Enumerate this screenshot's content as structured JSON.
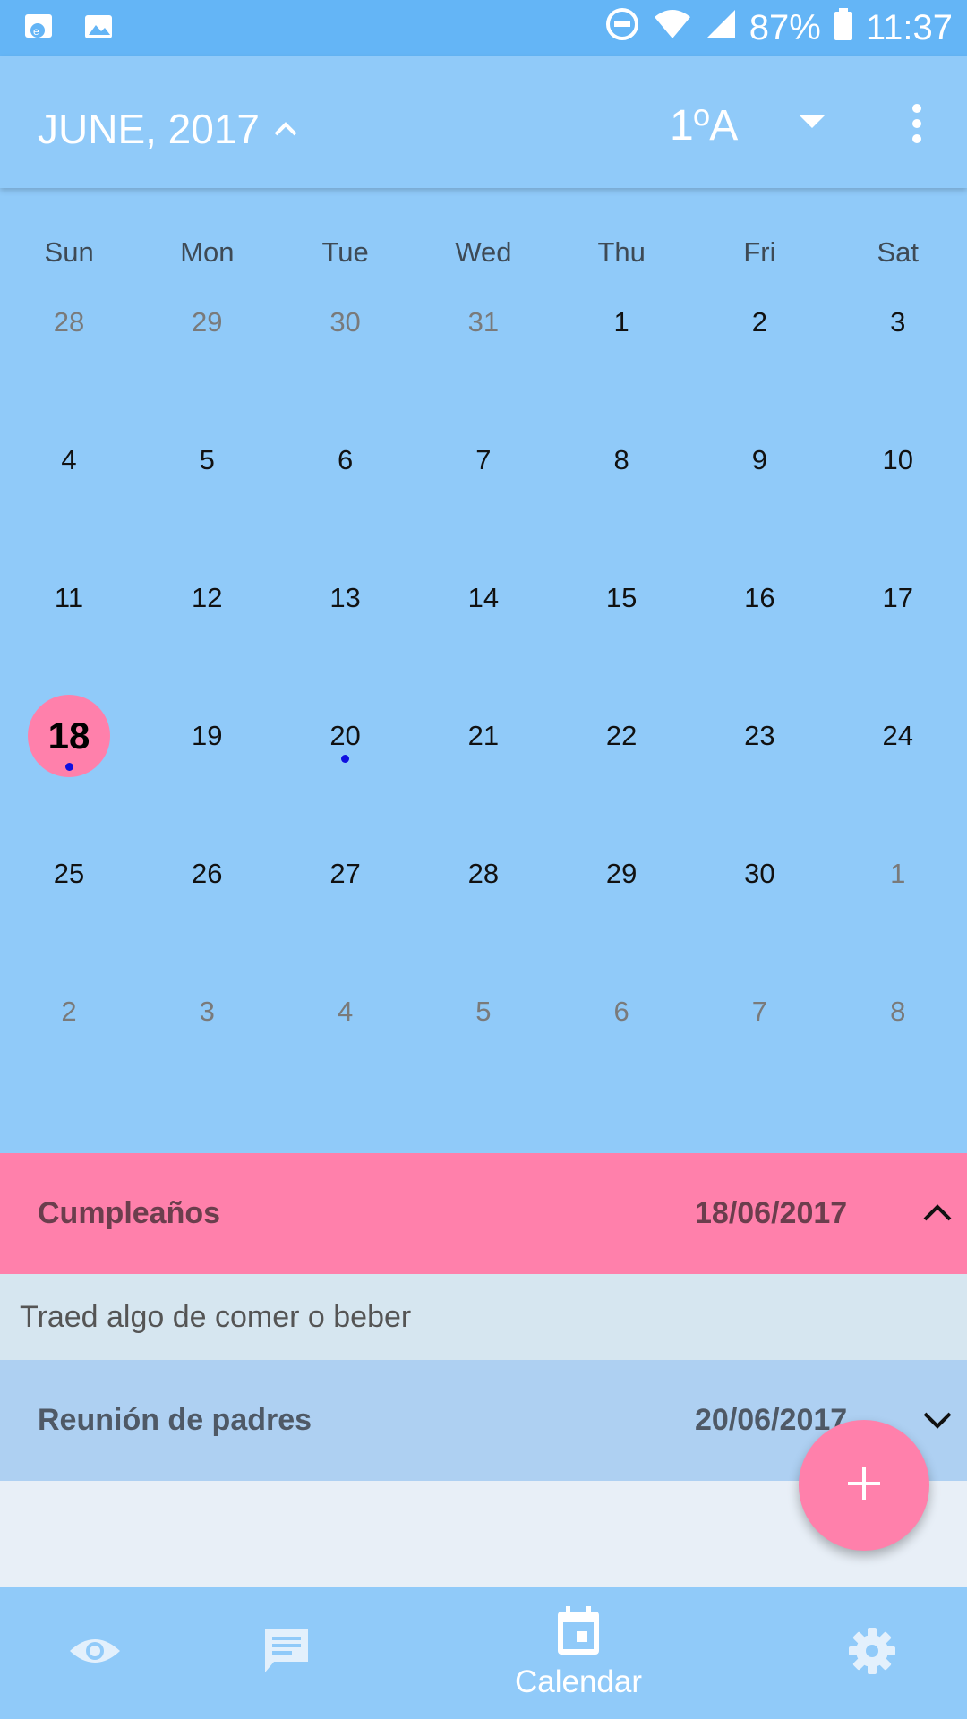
{
  "status_bar": {
    "battery": "87%",
    "time": "11:37",
    "icons": [
      "app-notification-icon",
      "image-notification-icon",
      "do-not-disturb-icon",
      "wifi-icon",
      "signal-icon",
      "battery-icon"
    ]
  },
  "app_bar": {
    "month_title": "JUNE, 2017",
    "class_selected": "1ºA",
    "icons": [
      "chevron-up-icon",
      "dropdown-caret-icon",
      "more-vert-icon"
    ]
  },
  "calendar": {
    "weekdays": [
      "Sun",
      "Mon",
      "Tue",
      "Wed",
      "Thu",
      "Fri",
      "Sat"
    ],
    "weeks": [
      [
        {
          "d": "28",
          "o": true
        },
        {
          "d": "29",
          "o": true
        },
        {
          "d": "30",
          "o": true
        },
        {
          "d": "31",
          "o": true
        },
        {
          "d": "1"
        },
        {
          "d": "2"
        },
        {
          "d": "3"
        }
      ],
      [
        {
          "d": "4"
        },
        {
          "d": "5"
        },
        {
          "d": "6"
        },
        {
          "d": "7"
        },
        {
          "d": "8"
        },
        {
          "d": "9"
        },
        {
          "d": "10"
        }
      ],
      [
        {
          "d": "11"
        },
        {
          "d": "12"
        },
        {
          "d": "13"
        },
        {
          "d": "14"
        },
        {
          "d": "15"
        },
        {
          "d": "16"
        },
        {
          "d": "17"
        }
      ],
      [
        {
          "d": "18",
          "today": true,
          "event": true
        },
        {
          "d": "19"
        },
        {
          "d": "20",
          "event": true
        },
        {
          "d": "21"
        },
        {
          "d": "22"
        },
        {
          "d": "23"
        },
        {
          "d": "24"
        }
      ],
      [
        {
          "d": "25"
        },
        {
          "d": "26"
        },
        {
          "d": "27"
        },
        {
          "d": "28"
        },
        {
          "d": "29"
        },
        {
          "d": "30"
        },
        {
          "d": "1",
          "o": true
        }
      ],
      [
        {
          "d": "2",
          "o": true
        },
        {
          "d": "3",
          "o": true
        },
        {
          "d": "4",
          "o": true
        },
        {
          "d": "5",
          "o": true
        },
        {
          "d": "6",
          "o": true
        },
        {
          "d": "7",
          "o": true
        },
        {
          "d": "8",
          "o": true
        }
      ]
    ]
  },
  "events": [
    {
      "title": "Cumpleaños",
      "date": "18/06/2017",
      "description": "Traed algo de comer o beber",
      "expanded": true
    },
    {
      "title": "Reunión de padres",
      "date": "20/06/2017",
      "expanded": false
    }
  ],
  "fab": {
    "icon": "plus-icon"
  },
  "bottom_nav": {
    "items": [
      {
        "icon": "eye-icon",
        "label": ""
      },
      {
        "icon": "chat-icon",
        "label": ""
      },
      {
        "icon": "calendar-icon",
        "label": "Calendar",
        "active": true
      },
      {
        "icon": "settings-icon",
        "label": ""
      }
    ]
  },
  "colors": {
    "primary": "#90CAF9",
    "primary_dark": "#64B5F6",
    "accent": "#FF80AB",
    "event_dot": "#1010E0"
  }
}
